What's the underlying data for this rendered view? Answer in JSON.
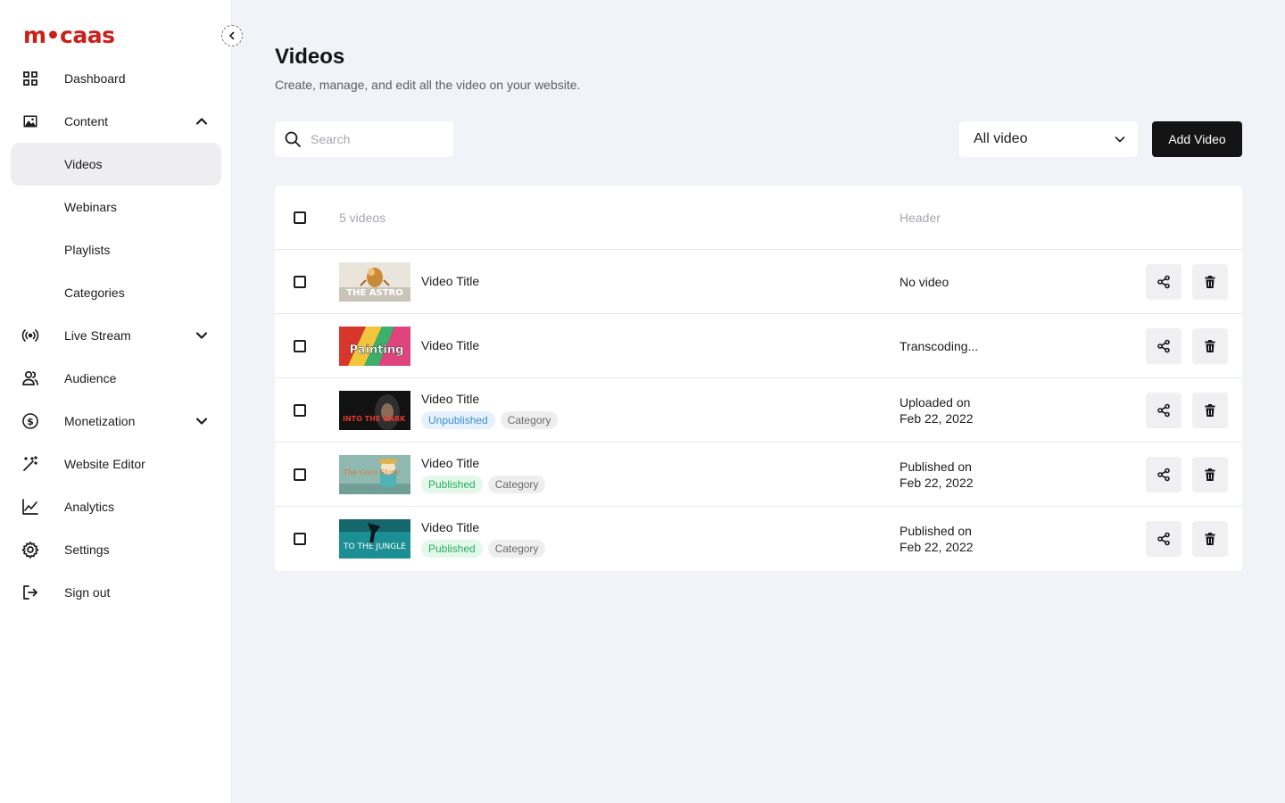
{
  "brand": {
    "logo_text": "m•caas",
    "logo_color": "#cc1f1a"
  },
  "sidebar": {
    "items": [
      {
        "label": "Dashboard",
        "icon": "grid-icon"
      },
      {
        "label": "Content",
        "icon": "image-icon",
        "chevron": "chevron-up-icon"
      },
      {
        "label": "Videos",
        "active": true
      },
      {
        "label": "Webinars"
      },
      {
        "label": "Playlists"
      },
      {
        "label": "Categories"
      },
      {
        "label": "Live Stream",
        "icon": "broadcast-icon",
        "chevron": "chevron-down-icon"
      },
      {
        "label": "Audience",
        "icon": "users-icon"
      },
      {
        "label": "Monetization",
        "icon": "dollar-circle-icon",
        "chevron": "chevron-down-icon"
      },
      {
        "label": "Website Editor",
        "icon": "magic-wand-icon"
      },
      {
        "label": "Analytics",
        "icon": "line-chart-icon"
      },
      {
        "label": "Settings",
        "icon": "gear-icon"
      },
      {
        "label": "Sign out",
        "icon": "sign-out-icon"
      }
    ]
  },
  "page": {
    "title": "Videos",
    "subtitle": "Create, manage, and edit all the video on your website."
  },
  "toolbar": {
    "search_placeholder": "Search",
    "filter_value": "All video",
    "add_label": "Add Video"
  },
  "table": {
    "count_label": "5 videos",
    "column_header": "Header",
    "rows": [
      {
        "title": "Video Title",
        "thumb_text": "THE ASTRO",
        "status_line1": "No video",
        "status_line2": "",
        "tags": []
      },
      {
        "title": "Video Title",
        "thumb_text": "Painting",
        "status_line1": "Transcoding...",
        "status_line2": "",
        "tags": []
      },
      {
        "title": "Video Title",
        "thumb_text": "INTO THE DARK",
        "status_line1": "Uploaded on",
        "status_line2": "Feb 22, 2022",
        "tags": [
          "Unpublished",
          "Category"
        ]
      },
      {
        "title": "Video Title",
        "thumb_text": "The Coco Story",
        "status_line1": "Published on",
        "status_line2": "Feb 22, 2022",
        "tags": [
          "Published",
          "Category"
        ]
      },
      {
        "title": "Video Title",
        "thumb_text": "TO THE JUNGLE",
        "status_line1": "Published on",
        "status_line2": "Feb 22, 2022",
        "tags": [
          "Published",
          "Category"
        ]
      }
    ]
  },
  "colors": {
    "accent": "#141414",
    "unpublished": "#3a8fd9",
    "published": "#24b05a"
  }
}
